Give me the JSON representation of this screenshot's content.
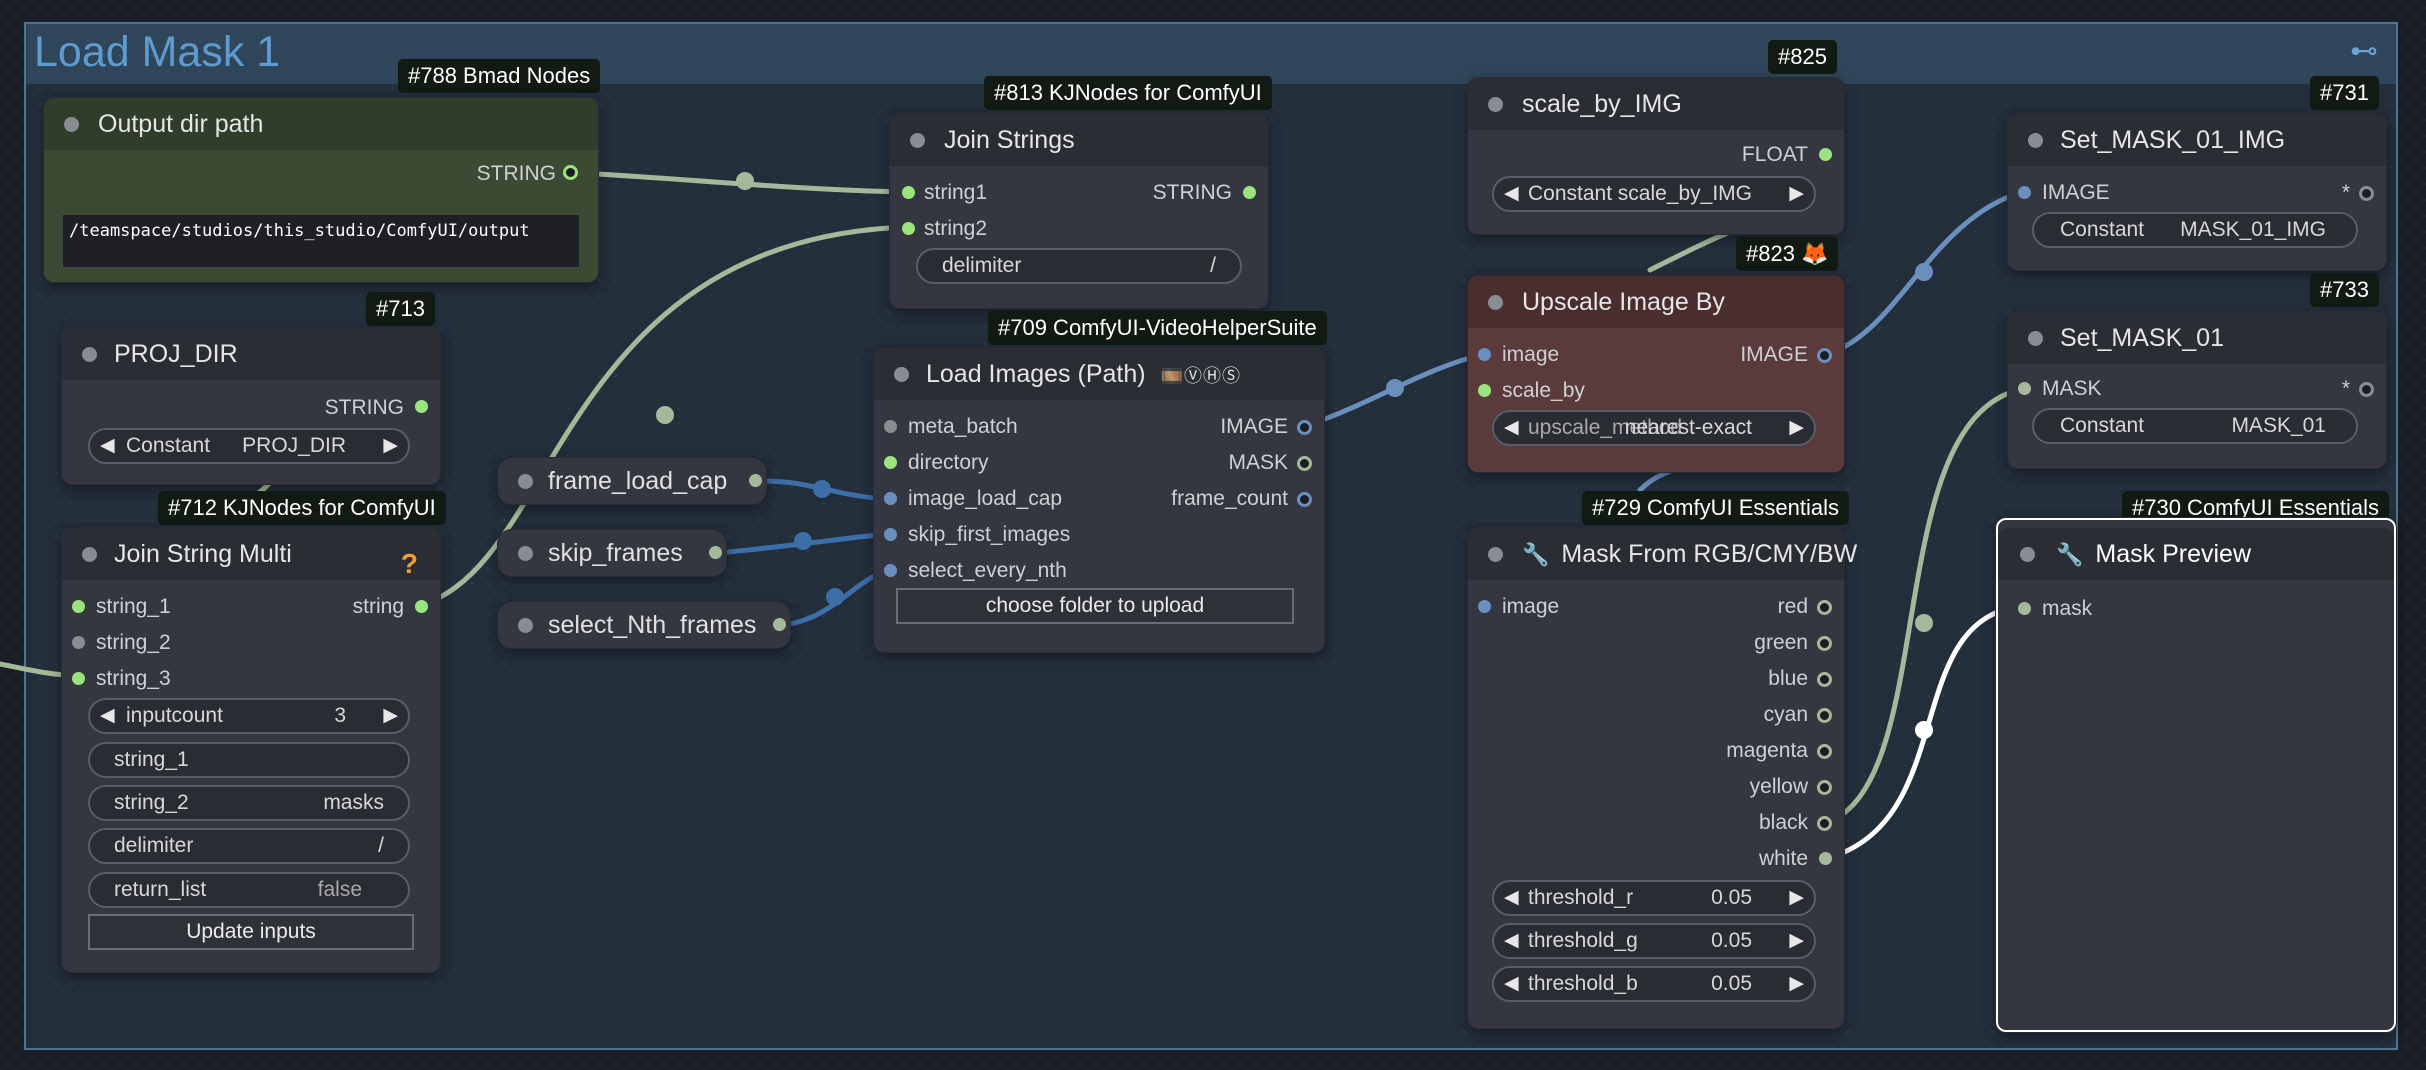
{
  "group": {
    "title": "Load Mask 1"
  },
  "nodes": {
    "output_dir": {
      "badge": "#788 Bmad Nodes",
      "title": "Output dir path",
      "out": "STRING",
      "value": "/teamspace/studios/this_studio/ComfyUI/output",
      "color": "#3d4a33"
    },
    "proj_dir": {
      "badge": "#713",
      "title": "PROJ_DIR",
      "out": "STRING",
      "widget_label": "Constant",
      "widget_value": "PROJ_DIR"
    },
    "join_multi": {
      "badge": "#712 KJNodes for ComfyUI",
      "title": "Join String Multi",
      "inputs": [
        "string_1",
        "string_2",
        "string_3"
      ],
      "out": "string",
      "inputcount_label": "inputcount",
      "inputcount_value": "3",
      "w_string1": "string_1",
      "w_string2": "string_2",
      "w_string2_value": "masks",
      "w_delim": "delimiter",
      "w_delim_value": "/",
      "w_return": "return_list",
      "w_return_value": "false",
      "button": "Update inputs"
    },
    "join_strings": {
      "badge": "#813 KJNodes for ComfyUI",
      "title": "Join Strings",
      "inputs": [
        "string1",
        "string2"
      ],
      "out": "STRING",
      "delim_label": "delimiter",
      "delim_value": "/"
    },
    "reroutes": [
      "frame_load_cap",
      "skip_frames",
      "select_Nth_frames"
    ],
    "load_images": {
      "badge": "#709 ComfyUI-VideoHelperSuite",
      "title": "Load Images (Path)",
      "title_icons": "🎞️ⓋⒽⓈ",
      "inputs": [
        "meta_batch",
        "directory",
        "image_load_cap",
        "skip_first_images",
        "select_every_nth"
      ],
      "outputs": [
        "IMAGE",
        "MASK",
        "frame_count"
      ],
      "button": "choose folder to upload"
    },
    "scale_by_img": {
      "badge": "#825",
      "title": "scale_by_IMG",
      "out": "FLOAT",
      "widget_label": "Constant",
      "widget_value": "scale_by_IMG"
    },
    "upscale": {
      "badge": "#823",
      "badge_icon": "🦊",
      "title": "Upscale Image By",
      "inputs": [
        "image",
        "scale_by"
      ],
      "out": "IMAGE",
      "widget_label": "upscale_method",
      "widget_value": "nearest-exact",
      "color": "#5a3a3a"
    },
    "mask_from_rgb": {
      "badge": "#729 ComfyUI Essentials",
      "title": "Mask From RGB/CMY/BW",
      "input": "image",
      "outputs": [
        "red",
        "green",
        "blue",
        "cyan",
        "magenta",
        "yellow",
        "black",
        "white"
      ],
      "thresholds": [
        {
          "label": "threshold_r",
          "value": "0.05"
        },
        {
          "label": "threshold_g",
          "value": "0.05"
        },
        {
          "label": "threshold_b",
          "value": "0.05"
        }
      ]
    },
    "set_mask_img": {
      "badge": "#731",
      "title": "Set_MASK_01_IMG",
      "input": "IMAGE",
      "out": "*",
      "widget_label": "Constant",
      "widget_value": "MASK_01_IMG"
    },
    "set_mask": {
      "badge": "#733",
      "title": "Set_MASK_01",
      "input": "MASK",
      "out": "*",
      "widget_label": "Constant",
      "widget_value": "MASK_01"
    },
    "mask_preview": {
      "badge": "#730 ComfyUI Essentials",
      "title": "Mask Preview",
      "input": "mask"
    }
  },
  "icons": {
    "pin": "pin-icon",
    "wrench": "wrench-icon",
    "help": "help-icon",
    "fox": "fox-icon",
    "arrow_left": "◀",
    "arrow_right": "▶"
  },
  "colors": {
    "wire_green": "#a5b99a",
    "wire_blue": "#6a8fbd",
    "wire_white": "#ffffff",
    "accent": "#9be37d"
  }
}
